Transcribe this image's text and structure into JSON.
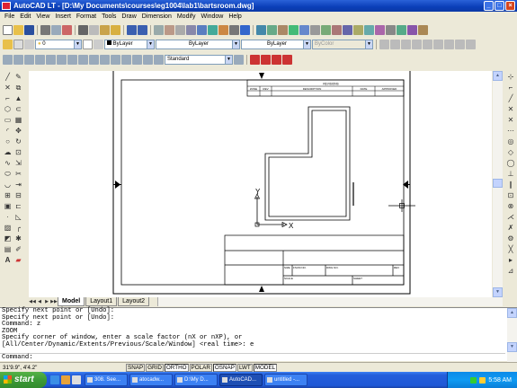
{
  "window": {
    "title": "AutoCAD LT - [D:\\My Documents\\courses\\eg1004\\lab1\\bartsroom.dwg]"
  },
  "menu": [
    "File",
    "Edit",
    "View",
    "Insert",
    "Format",
    "Tools",
    "Draw",
    "Dimension",
    "Modify",
    "Window",
    "Help"
  ],
  "toolbar2": {
    "layer": "0",
    "color": "ByLayer",
    "linetype": "ByLayer",
    "lineweight": "ByLayer",
    "plotstyle": "ByColor"
  },
  "toolbar3": {
    "textstyle": "Standard"
  },
  "drawing": {
    "revisions": {
      "title": "REVISIONS",
      "headers": [
        "ZONE",
        "REV",
        "DESCRIPTION",
        "DATE",
        "APPROVED"
      ]
    },
    "titleblock": {
      "size": "SIZE",
      "fscm": "FSCM NO.",
      "dwg": "DWG NO.",
      "rev": "REV",
      "scale": "SCALE",
      "sheet": "SHEET"
    },
    "ucs": {
      "x": "X",
      "y": "Y"
    }
  },
  "tabs": [
    "Model",
    "Layout1",
    "Layout2"
  ],
  "command": {
    "history": [
      "Specify next point or [Undo]:",
      "Specify next point or [Undo]:",
      "Command: z",
      "ZOOM",
      "Specify corner of window, enter a scale factor (nX or nXP), or",
      "[All/Center/Dynamic/Extents/Previous/Scale/Window] <real time>: e"
    ],
    "prompt": "Command:"
  },
  "status": {
    "coords": "31'9.9\",  4'4.2\"",
    "buttons": [
      "SNAP",
      "GRID",
      "ORTHO",
      "POLAR",
      "OSNAP",
      "LWT",
      "MODEL"
    ]
  },
  "taskbar": {
    "start": "start",
    "tasks": [
      "308. See...",
      "atocadw...",
      "D:\\My D...",
      "AutoCAD...",
      "untitled -..."
    ],
    "clock": "5:58 AM"
  }
}
